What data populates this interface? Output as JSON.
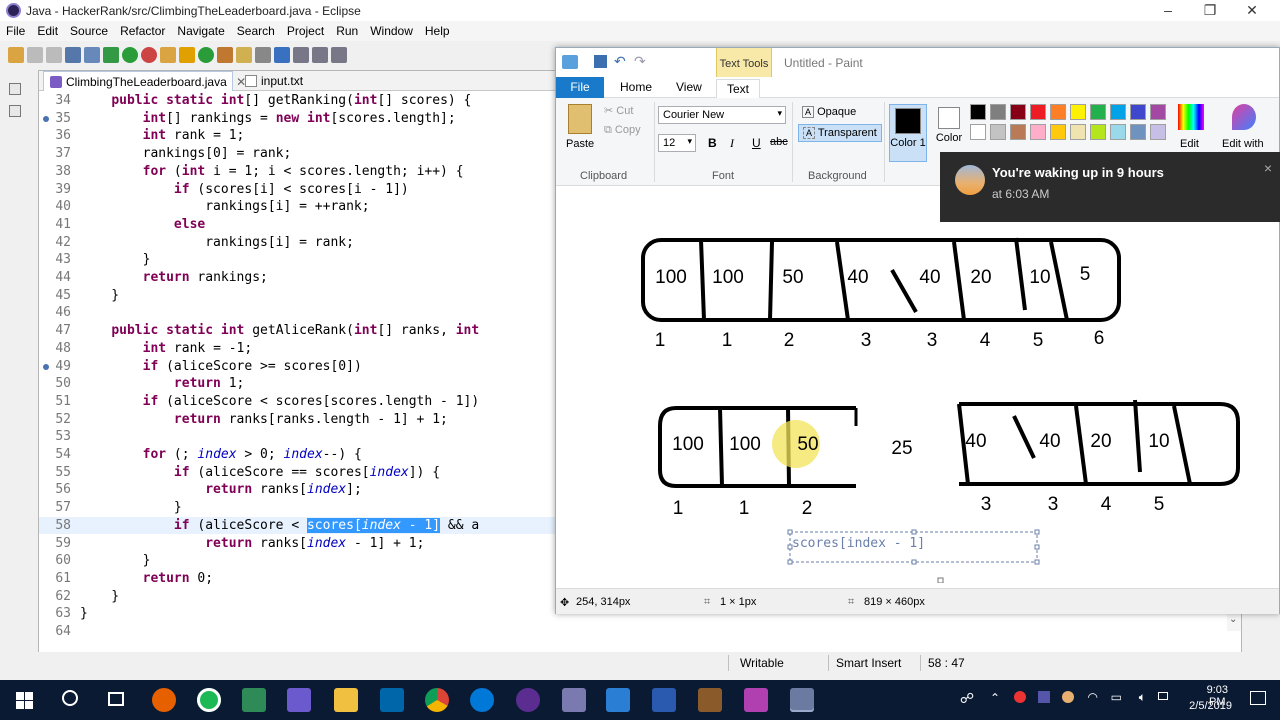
{
  "eclipse": {
    "title": "Java - HackerRank/src/ClimbingTheLeaderboard.java - Eclipse",
    "menu": [
      "File",
      "Edit",
      "Source",
      "Refactor",
      "Navigate",
      "Search",
      "Project",
      "Run",
      "Window",
      "Help"
    ],
    "tabs": [
      {
        "label": "ClimbingTheLeaderboard.java",
        "active": true
      },
      {
        "label": "input.txt",
        "active": false
      }
    ],
    "status": {
      "writable": "Writable",
      "insert": "Smart Insert",
      "position": "58 : 47"
    }
  },
  "code": {
    "lines": [
      {
        "n": "34",
        "text": "    public static int[] getRanking(int[] scores) {"
      },
      {
        "n": "35",
        "text": "        int[] rankings = new int[scores.length];"
      },
      {
        "n": "36",
        "text": "        int rank = 1;"
      },
      {
        "n": "37",
        "text": "        rankings[0] = rank;"
      },
      {
        "n": "38",
        "text": "        for (int i = 1; i < scores.length; i++) {"
      },
      {
        "n": "39",
        "text": "            if (scores[i] < scores[i - 1])"
      },
      {
        "n": "40",
        "text": "                rankings[i] = ++rank;"
      },
      {
        "n": "41",
        "text": "            else"
      },
      {
        "n": "42",
        "text": "                rankings[i] = rank;"
      },
      {
        "n": "43",
        "text": "        }"
      },
      {
        "n": "44",
        "text": "        return rankings;"
      },
      {
        "n": "45",
        "text": "    }"
      },
      {
        "n": "46",
        "text": ""
      },
      {
        "n": "47",
        "text": "    public static int getAliceRank(int[] ranks, int"
      },
      {
        "n": "48",
        "text": "        int rank = -1;"
      },
      {
        "n": "49",
        "text": "        if (aliceScore >= scores[0])"
      },
      {
        "n": "50",
        "text": "            return 1;"
      },
      {
        "n": "51",
        "text": "        if (aliceScore < scores[scores.length - 1])"
      },
      {
        "n": "52",
        "text": "            return ranks[ranks.length - 1] + 1;"
      },
      {
        "n": "53",
        "text": ""
      },
      {
        "n": "54",
        "text": "        for (; index > 0; index--) {"
      },
      {
        "n": "55",
        "text": "            if (aliceScore == scores[index]) {"
      },
      {
        "n": "56",
        "text": "                return ranks[index];"
      },
      {
        "n": "57",
        "text": "            }"
      },
      {
        "n": "58",
        "text": "            if (aliceScore < scores[index - 1] && a"
      },
      {
        "n": "59",
        "text": "                return ranks[index - 1] + 1;"
      },
      {
        "n": "60",
        "text": "        }"
      },
      {
        "n": "61",
        "text": "        return 0;"
      },
      {
        "n": "62",
        "text": "    }"
      },
      {
        "n": "63",
        "text": "}"
      },
      {
        "n": "64",
        "text": ""
      }
    ]
  },
  "paint": {
    "title": "Untitled - Paint",
    "context_tab": "Text Tools",
    "tabs": [
      "File",
      "Home",
      "View",
      "Text"
    ],
    "clipboard": {
      "paste": "Paste",
      "cut": "Cut",
      "copy": "Copy",
      "group": "Clipboard"
    },
    "font": {
      "name": "Courier New",
      "size": "12",
      "group": "Font",
      "bold": "B",
      "italic": "I",
      "underline": "U",
      "strike": "abc"
    },
    "background": {
      "opaque": "Opaque",
      "transparent": "Transparent",
      "group": "Background"
    },
    "color1": "Color 1",
    "color2": "Color",
    "edit_colors": "Edit",
    "edit_with": "Edit with",
    "palette": [
      "#000000",
      "#7f7f7f",
      "#880015",
      "#ed1c24",
      "#ff7f27",
      "#fff200",
      "#22b14c",
      "#00a2e8",
      "#3f48cc",
      "#a349a4",
      "#ffffff",
      "#c3c3c3",
      "#b97a57",
      "#ffaec9",
      "#ffc90e",
      "#efe4b0",
      "#b5e61d",
      "#99d9ea",
      "#7092be",
      "#c8bfe7"
    ],
    "status": {
      "cursor": "254, 314px",
      "selection": "1 × 1px",
      "canvas": "819 × 460px"
    },
    "drawing": {
      "top_values": [
        "100",
        "100",
        "50",
        "40",
        "40",
        "20",
        "10",
        "5"
      ],
      "top_ranks": [
        "1",
        "1",
        "2",
        "3",
        "3",
        "4",
        "5",
        "6"
      ],
      "left_values": [
        "100",
        "100",
        "50"
      ],
      "left_ranks": [
        "1",
        "1",
        "2"
      ],
      "middle_value": "25",
      "right_values": [
        "40",
        "40",
        "20",
        "10"
      ],
      "right_ranks": [
        "3",
        "3",
        "4",
        "5"
      ],
      "textbox": "scores[index - 1]"
    }
  },
  "toast": {
    "title": "You're waking up in 9 hours",
    "subtitle": "at 6:03 AM",
    "close": "×"
  },
  "taskbar": {
    "time": "9:03 PM",
    "date": "2/5/2019"
  }
}
